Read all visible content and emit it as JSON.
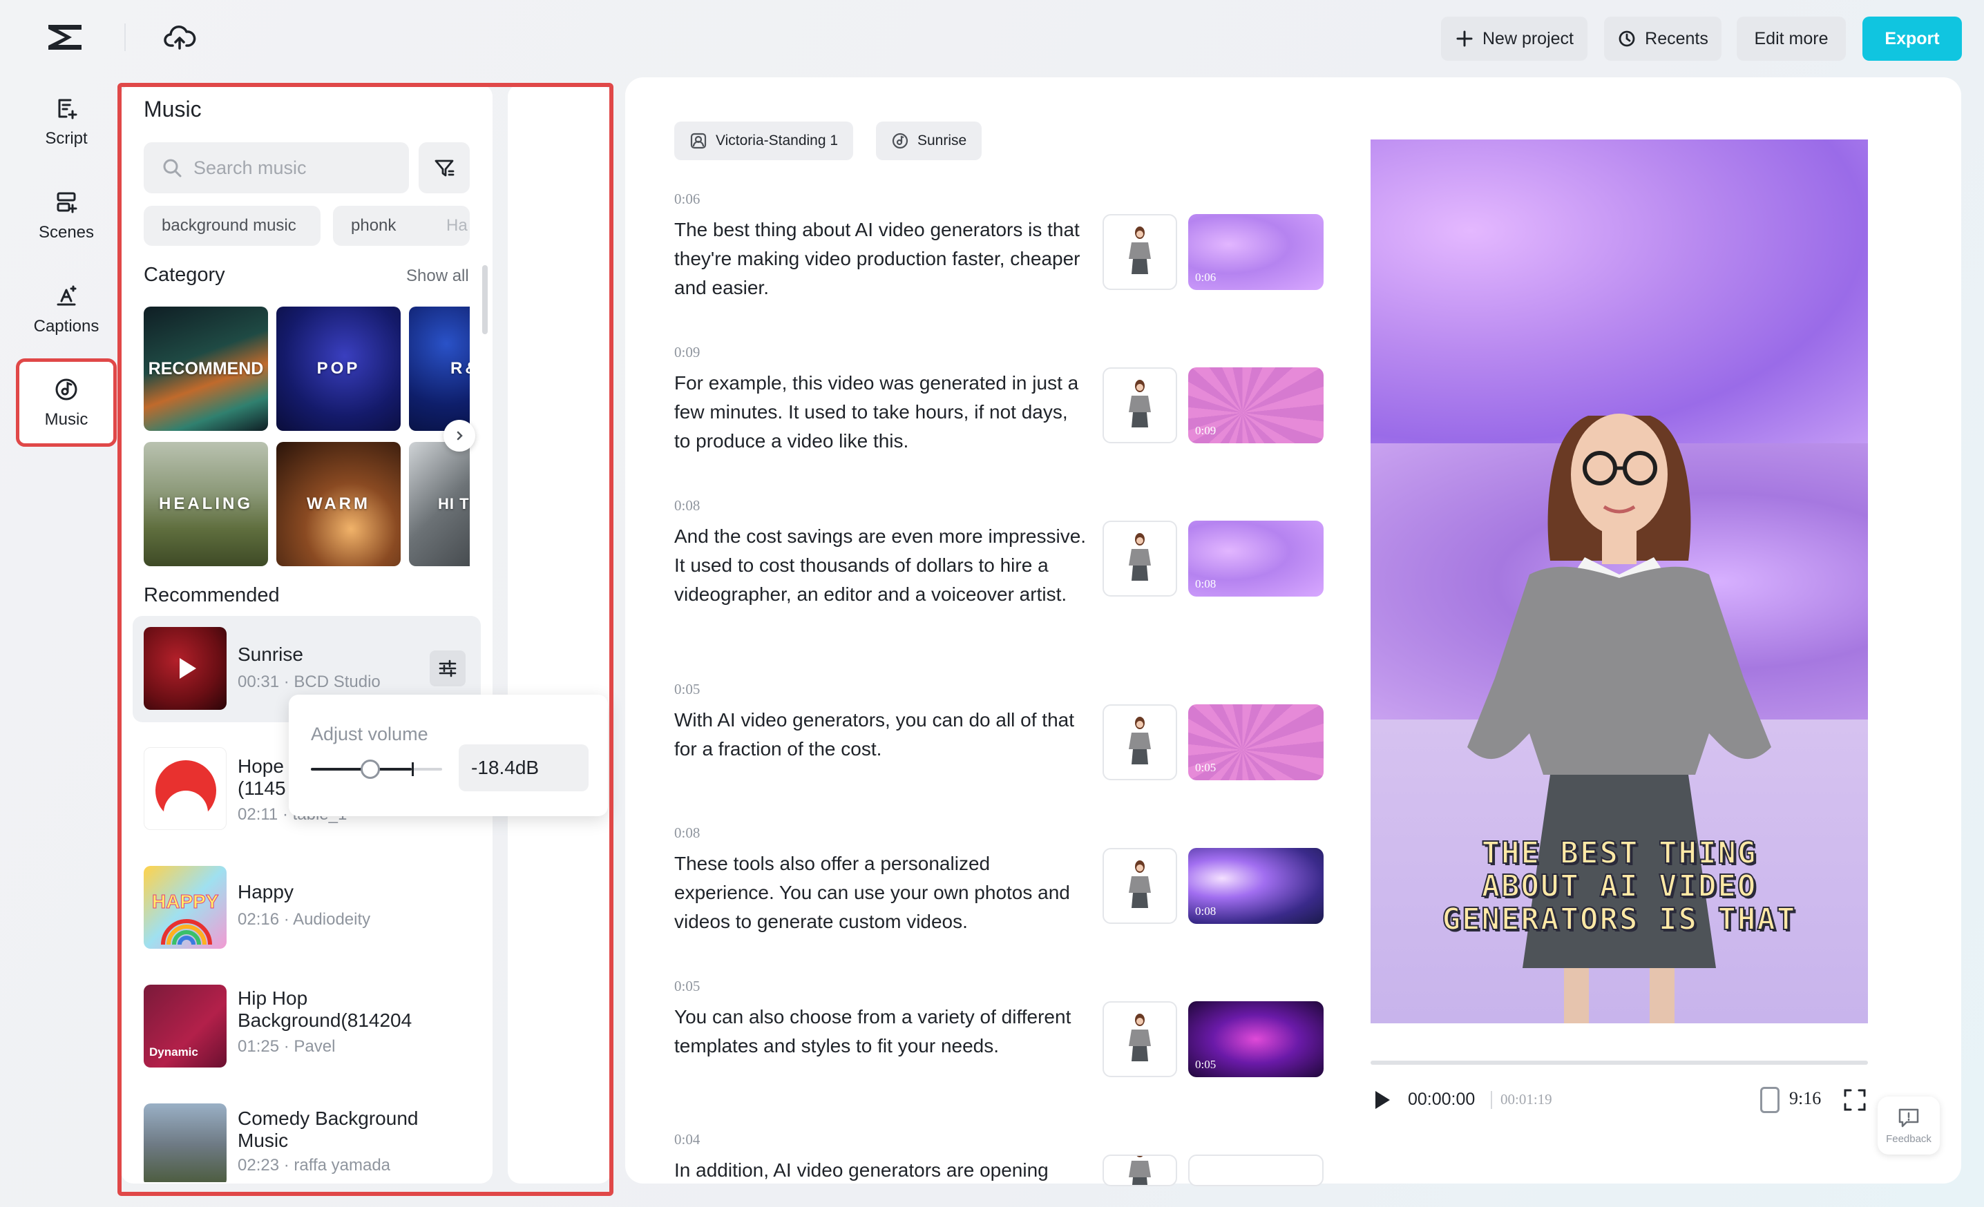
{
  "topbar": {
    "new_project": "New project",
    "recents": "Recents",
    "edit_more": "Edit more",
    "export": "Export"
  },
  "nav": [
    {
      "label": "Script",
      "icon": "script-icon"
    },
    {
      "label": "Scenes",
      "icon": "scenes-icon"
    },
    {
      "label": "Captions",
      "icon": "captions-icon"
    },
    {
      "label": "Music",
      "icon": "music-icon",
      "active": true
    }
  ],
  "music_panel": {
    "title": "Music",
    "search_placeholder": "Search music",
    "chips": [
      "background music",
      "phonk",
      "Ha"
    ],
    "category_title": "Category",
    "show_all": "Show all",
    "categories": [
      "RECOMMEND",
      "POP",
      "R&",
      "HEALING",
      "WARM",
      "HI TEM"
    ],
    "recommended_title": "Recommended",
    "tracks": [
      {
        "name": "Sunrise",
        "meta": "00:31 · BCD Studio"
      },
      {
        "name": "Hope (1145",
        "meta": "02:11 · table_1"
      },
      {
        "name": "Happy",
        "meta": "02:16 · Audiodeity"
      },
      {
        "name": "Hip Hop Background(814204",
        "meta": "01:25 · Pavel"
      },
      {
        "name": "Comedy Background Music",
        "meta": "02:23 · raffa yamada"
      }
    ],
    "cover_labels": {
      "happy": "HAPPY",
      "hiphop": "Dynamic"
    },
    "volume": {
      "title": "Adjust volume",
      "value": "-18.4dB",
      "level": 0.45
    }
  },
  "script": {
    "tags": [
      "Victoria-Standing 1",
      "Sunrise"
    ],
    "scenes": [
      {
        "duration": "0:06",
        "text": "The best thing about AI video generators is that they're making video production faster, cheaper and easier.",
        "thumb_label": "0:06"
      },
      {
        "duration": "0:09",
        "text": "For example, this video was generated in just a few minutes. It used to take hours, if not days, to produce a video like this.",
        "thumb_label": "0:09"
      },
      {
        "duration": "0:08",
        "text": "And the cost savings are even more impressive. It used to cost thousands of dollars to hire a videographer, an editor and a voiceover artist.",
        "thumb_label": "0:08"
      },
      {
        "duration": "0:05",
        "text": "With AI video generators, you can do all of that for a fraction of the cost.",
        "thumb_label": "0:05"
      },
      {
        "duration": "0:08",
        "text": "These tools also offer a personalized experience. You can use your own photos and videos to generate custom videos.",
        "thumb_label": "0:08"
      },
      {
        "duration": "0:05",
        "text": "You can also choose from a variety of different templates and styles to fit your needs.",
        "thumb_label": "0:05"
      },
      {
        "duration": "0:04",
        "text": "In addition, AI video generators are opening",
        "thumb_label": ""
      }
    ]
  },
  "preview": {
    "caption": "THE BEST THING ABOUT AI VIDEO GENERATORS IS THAT",
    "current_time": "00:00:00",
    "total_time": "00:01:19",
    "ratio": "9:16",
    "feedback": "Feedback"
  }
}
